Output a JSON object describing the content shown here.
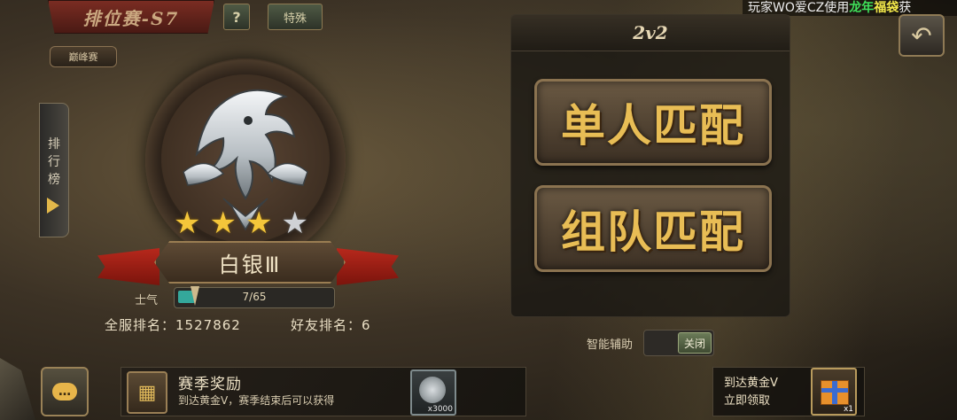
{
  "header": {
    "season_title": "排位赛-S7",
    "help_label": "?",
    "tip_label": "特殊",
    "marquee_prefix": "玩家WO爱CZ使用",
    "marquee_highlight": "龙年",
    "marquee_highlight2": "福袋",
    "marquee_suffix": "获",
    "back_icon": "back-arrow-icon"
  },
  "left": {
    "peak_tag": "巅峰赛",
    "ranking_tab": "排\n行\n榜",
    "tier_name": "白银Ⅲ",
    "stars_total": 4,
    "stars_filled": 3,
    "morale_label": "士气",
    "morale_text": "7/65",
    "morale_fraction": 0.108,
    "server_rank_label": "全服排名：",
    "server_rank_value": "1527862",
    "friend_rank_label": "好友排名：",
    "friend_rank_value": "6"
  },
  "mode_panel": {
    "title": "2v2",
    "solo_label": "单人匹配",
    "team_label": "组队匹配"
  },
  "assist": {
    "label": "智能辅助",
    "toggle_label": "关闭"
  },
  "bottom": {
    "chat_icon": "chat-bubble-icon",
    "reward_title": "赛季奖励",
    "reward_desc": "到达黄金Ⅴ，赛季结束后可以获得",
    "coin_qty": "x3000",
    "gold_line1": "到达黄金Ⅴ",
    "gold_line2": "立即领取",
    "gift_qty": "x1"
  },
  "colors": {
    "accent_gold": "#e8bd55",
    "morale_fill": "#34a89b",
    "ribbon_red": "#b7281c"
  }
}
